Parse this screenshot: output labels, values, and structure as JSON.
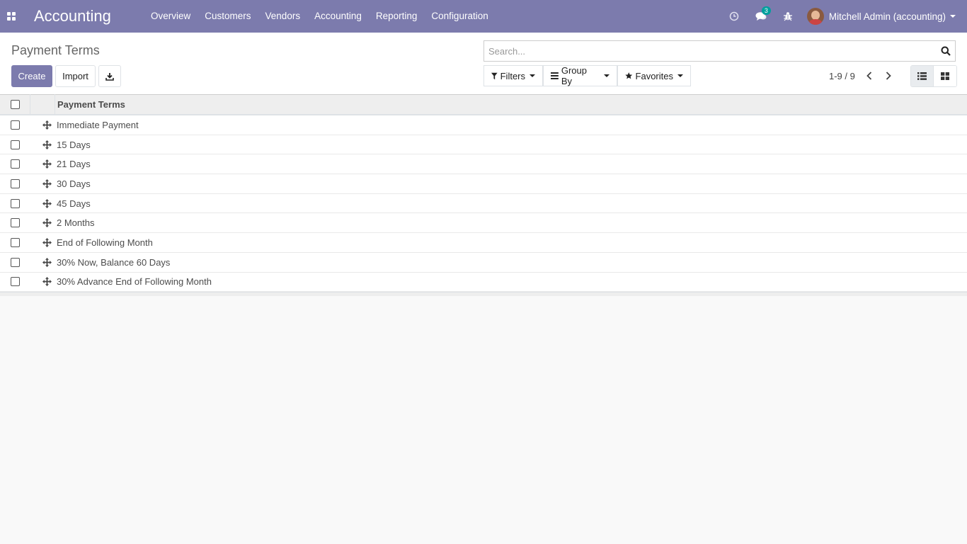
{
  "navbar": {
    "app_title": "Accounting",
    "menu": [
      "Overview",
      "Customers",
      "Vendors",
      "Accounting",
      "Reporting",
      "Configuration"
    ],
    "messages_count": "3",
    "user_name": "Mitchell Admin (accounting)"
  },
  "control_panel": {
    "title": "Payment Terms",
    "create_label": "Create",
    "import_label": "Import",
    "search_placeholder": "Search...",
    "filters_label": "Filters",
    "groupby_label": "Group By",
    "favorites_label": "Favorites",
    "pager_text": "1-9 / 9"
  },
  "table": {
    "column_header": "Payment Terms",
    "rows": [
      "Immediate Payment",
      "15 Days",
      "21 Days",
      "30 Days",
      "45 Days",
      "2 Months",
      "End of Following Month",
      "30% Now, Balance 60 Days",
      "30% Advance End of Following Month"
    ]
  },
  "colors": {
    "brand": "#7c7bad",
    "badge": "#00a09d"
  }
}
